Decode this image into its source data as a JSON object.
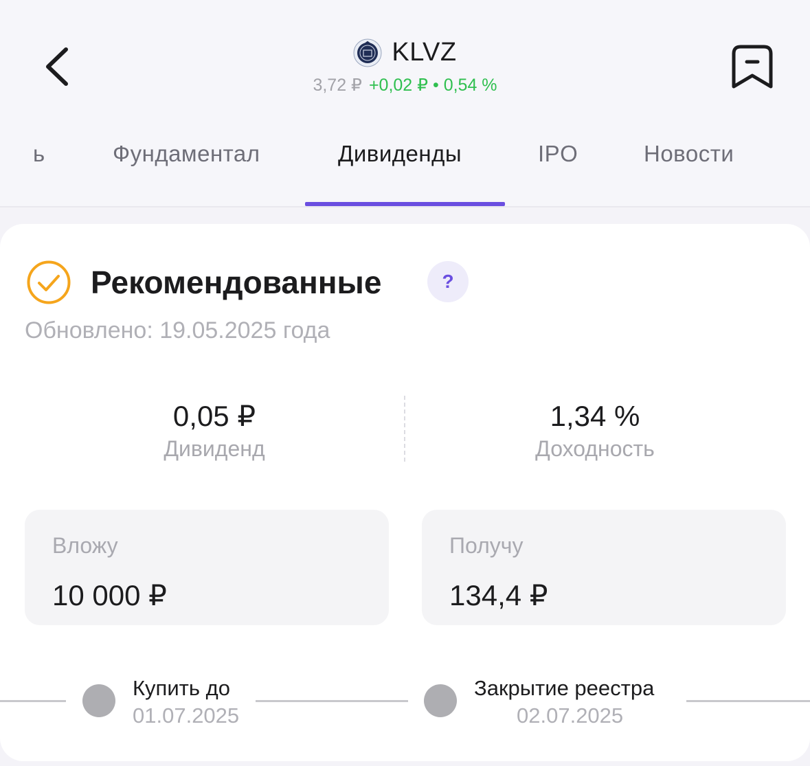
{
  "header": {
    "ticker": "KLVZ",
    "price": "3,72 ₽",
    "change": "+0,02 ₽ • 0,54 %",
    "colors": {
      "positive": "#2fbf4f",
      "accent": "#6a4ee0"
    },
    "icons": {
      "back": "chevron-left-icon",
      "bookmark": "bookmark-remove-icon",
      "logo": "company-logo-icon"
    }
  },
  "tabs": [
    {
      "label": "ь",
      "active": false
    },
    {
      "label": "Фундаментал",
      "active": false
    },
    {
      "label": "Дивиденды",
      "active": true
    },
    {
      "label": "IPO",
      "active": false
    },
    {
      "label": "Новости",
      "active": false
    }
  ],
  "card": {
    "title": "Рекомендованные",
    "help_label": "?",
    "updated": "Обновлено: 19.05.2025 года",
    "icons": {
      "status": "check-circle-icon"
    },
    "stats": [
      {
        "value": "0,05 ₽",
        "label": "Дивиденд"
      },
      {
        "value": "1,34 %",
        "label": "Доходность"
      }
    ],
    "invest": {
      "label": "Вложу",
      "value": "10 000 ₽"
    },
    "receive": {
      "label": "Получу",
      "value": "134,4 ₽"
    },
    "timeline": [
      {
        "label": "Купить до",
        "date": "01.07.2025"
      },
      {
        "label": "Закрытие реестра",
        "date": "02.07.2025"
      }
    ]
  }
}
